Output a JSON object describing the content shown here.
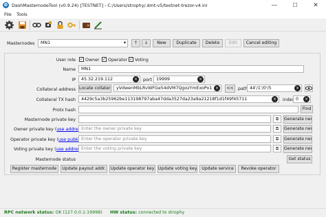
{
  "window": {
    "title": "DashMasternodeTool (v0.9.24) [TESTNET] - C:/Users/strophy/.dmt-v5/testnet-trezor-v4.ini",
    "app_icon": "Đ",
    "minimize": "—",
    "maximize": "☐",
    "close": "✕"
  },
  "menu": {
    "file": "File",
    "tools": "Tools"
  },
  "toolbar": {
    "icons": [
      "gear-icon",
      "save-icon",
      "connect-icon",
      "hw-wallet-icon",
      "lock-icon",
      "wallet-icon",
      "sign-icon"
    ]
  },
  "masternodes": {
    "label": "Masternodes",
    "selected": "MN1",
    "new": "New",
    "duplicate": "Duplicate",
    "delete": "Delete",
    "edit": "Edit",
    "cancel": "Cancel editing"
  },
  "form": {
    "user_role_label": "User role",
    "owner": "Owner",
    "operator": "Operator",
    "voting": "Voting",
    "name_label": "Name",
    "name": "MN1",
    "ip_label": "IP",
    "ip": "45.32.219.112",
    "port_label": "port",
    "port": "19999",
    "collateral_address_label": "Collateral address",
    "locate_collateral": "Locate collateral",
    "collateral_address": "yVdwenMbLRvWFGe54dVM7QgozYmExoPo1",
    "arrows": "<<",
    "path_label": "path",
    "path": "44'/1'/0'/5",
    "tx_hash_label": "Collateral TX hash",
    "tx_hash": "4429c5a3b25962be113198797aba47dda3527da23a9a21218f1d1f49f45711",
    "index_label": "index",
    "index": "0",
    "protx_label": "Protx hash",
    "find": "Find",
    "mn_priv_label": "Masternode private key",
    "mn_priv": "",
    "generate": "Generate new",
    "owner_priv_prefix": "Owner private key (",
    "owner_priv_link": "use address",
    "owner_priv_suffix": ")",
    "owner_priv_ph": "Enter the owner private key",
    "operator_priv_prefix": "Operator private key (",
    "operator_priv_link": "use pubkey",
    "operator_priv_suffix": ")",
    "operator_priv_ph": "Enter the operator private key",
    "voting_priv_prefix": "Voting private key (",
    "voting_priv_link": "use address",
    "voting_priv_suffix": ")",
    "voting_priv_ph": "Enter the voting private key",
    "status_label": "Masternode status",
    "get_status": "Get status"
  },
  "actions": {
    "register": "Register masternode",
    "payout": "Update payout addr.",
    "operator_key": "Update operator key",
    "voting_key": "Update voting key",
    "service": "Update service",
    "revoke": "Revoke operator"
  },
  "status": {
    "rpc_label": "RPC network status:",
    "rpc_value": "OK (127.0.0.1:19998)",
    "hw_label": "HW status:",
    "hw_value": "connected to strophy"
  },
  "colors": {
    "accent": "#1c75bc",
    "ok": "#1a7a1a",
    "link": "#0000ee"
  }
}
